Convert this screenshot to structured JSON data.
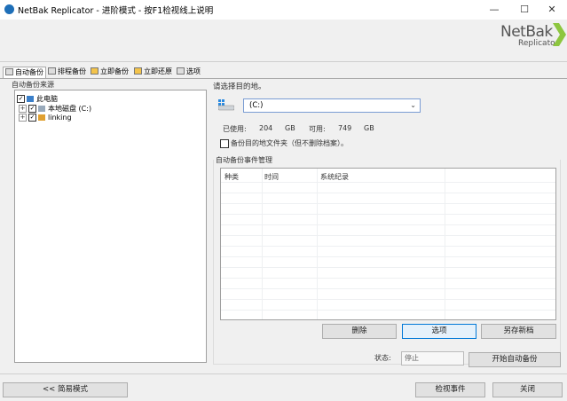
{
  "window": {
    "title": "NetBak Replicator - 进阶模式 - 按F1检视线上说明",
    "minimize": "—",
    "maximize": "☐",
    "close": "✕"
  },
  "logo": {
    "line1": "NetBak",
    "line2": "Replicator"
  },
  "tabs": [
    {
      "label": "自动备份",
      "active": true
    },
    {
      "label": "排程备份"
    },
    {
      "label": "立即备份"
    },
    {
      "label": "立即还原"
    },
    {
      "label": "选项"
    }
  ],
  "source": {
    "group_label": "自动备份来源",
    "tree": [
      {
        "label": "此电脑",
        "expander": "",
        "checked": "✓"
      },
      {
        "label": "本地磁盘 (C:)",
        "expander": "+",
        "checked": "✓"
      },
      {
        "label": "linking",
        "expander": "+",
        "checked": "✓"
      }
    ]
  },
  "destination": {
    "prompt": "请选择目的地。",
    "drive_value": "(C:)",
    "used_label": "已使用:",
    "used_value": "204",
    "used_unit": "GB",
    "free_label": "可用:",
    "free_value": "749",
    "free_unit": "GB",
    "folder_option": "备份目的地文件夹（但不删除档案）。"
  },
  "events": {
    "group_label": "自动备份事件管理",
    "columns": [
      "种类",
      "时间",
      "系统纪录"
    ],
    "rows": []
  },
  "buttons": {
    "delete": "删除",
    "options": "选项",
    "save_new": "另存新档",
    "start_auto": "开始自动备份",
    "simple_mode": "<< 简易模式",
    "view_events": "检视事件",
    "close": "关闭"
  },
  "status": {
    "label": "状态:",
    "value": "停止"
  },
  "colors": {
    "accent_green": "#8dc63f",
    "focus_blue": "#0078d7",
    "windows_blue": "#1e6fb8"
  }
}
